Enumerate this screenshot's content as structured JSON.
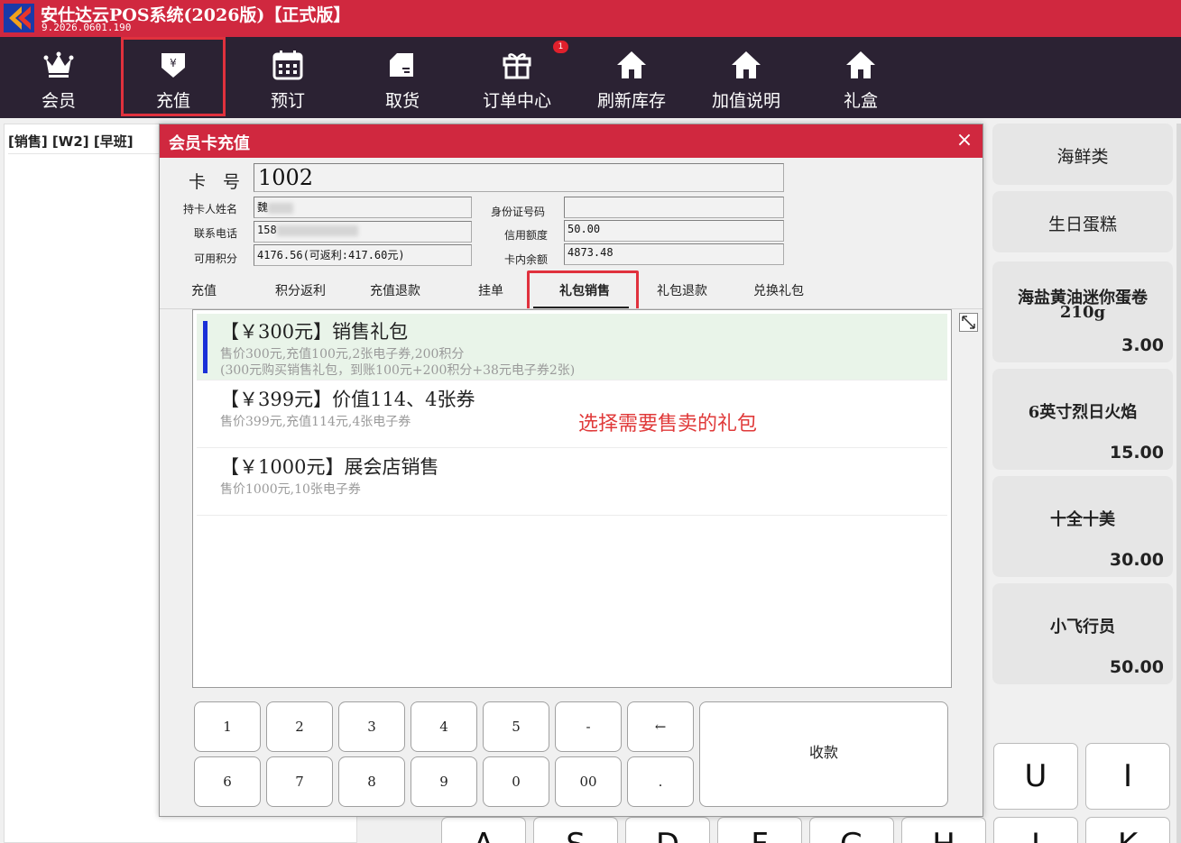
{
  "app": {
    "title": "安仕达云POS系统(2026版)【正式版】",
    "version": "9.2026.0601.190"
  },
  "nav": [
    {
      "label": "会员",
      "icon": "crown-icon"
    },
    {
      "label": "充值",
      "icon": "yen-tag-icon",
      "active": true
    },
    {
      "label": "预订",
      "icon": "calendar-icon"
    },
    {
      "label": "取货",
      "icon": "delivery-box-icon"
    },
    {
      "label": "订单中心",
      "icon": "gift-icon",
      "badge": "1"
    },
    {
      "label": "刷新库存",
      "icon": "home-icon"
    },
    {
      "label": "加值说明",
      "icon": "home-icon"
    },
    {
      "label": "礼盒",
      "icon": "home-icon"
    }
  ],
  "order_panel": {
    "header": "[销售] [W2] [早班]"
  },
  "products": [
    {
      "name": "海鲜类",
      "price": ""
    },
    {
      "name": "生日蛋糕",
      "price": ""
    },
    {
      "name": "海盐黄油迷你蛋卷",
      "name2": "210g",
      "price": "3.00"
    },
    {
      "name": "6英寸烈日火焰",
      "price": "15.00"
    },
    {
      "name": "十全十美",
      "price": "30.00"
    },
    {
      "name": "小飞行员",
      "price": "50.00"
    }
  ],
  "keyboard": {
    "row1": [
      "U",
      "I"
    ],
    "row2": [
      "A",
      "S",
      "D",
      "F",
      "G",
      "H",
      "J",
      "K"
    ]
  },
  "dialog": {
    "title": "会员卡充值",
    "close": "×",
    "labels": {
      "card_no": "卡　号",
      "holder_name": "持卡人姓名",
      "phone": "联系电话",
      "points": "可用积分",
      "id_no": "身份证号码",
      "credit": "信用额度",
      "balance": "卡内余额"
    },
    "values": {
      "card_no": "1002",
      "holder_name": "魏",
      "phone": "158",
      "points": "4176.56(可返利:417.60元)",
      "id_no": "",
      "credit": "50.00",
      "balance": "4873.48"
    },
    "tabs": [
      "充值",
      "积分返利",
      "充值退款",
      "挂单",
      "礼包销售",
      "礼包退款",
      "兑换礼包"
    ],
    "active_tab": "礼包销售",
    "packages": [
      {
        "title": "【￥300元】销售礼包",
        "desc1": "售价300元,充值100元,2张电子券,200积分",
        "desc2": "(300元购买销售礼包，到账100元+200积分+38元电子券2张)",
        "selected": true
      },
      {
        "title": "【￥399元】价值114、4张券",
        "desc1": "售价399元,充值114元,4张电子券",
        "desc2": ""
      },
      {
        "title": "【￥1000元】展会店销售",
        "desc1": "售价1000元,10张电子券",
        "desc2": ""
      }
    ],
    "annotation": "选择需要售卖的礼包",
    "keypad": {
      "row1": [
        "1",
        "2",
        "3",
        "4",
        "5",
        "-",
        "←"
      ],
      "row2": [
        "6",
        "7",
        "8",
        "9",
        "0",
        "00",
        "."
      ],
      "pay": "收款"
    }
  },
  "colors": {
    "brand_red": "#d0283f",
    "nav_bg": "#2b2233",
    "highlight": "#e0313d",
    "selected_bg": "#e9f4e9",
    "selected_bar": "#1a30d8",
    "annotation": "#e03a3a"
  }
}
